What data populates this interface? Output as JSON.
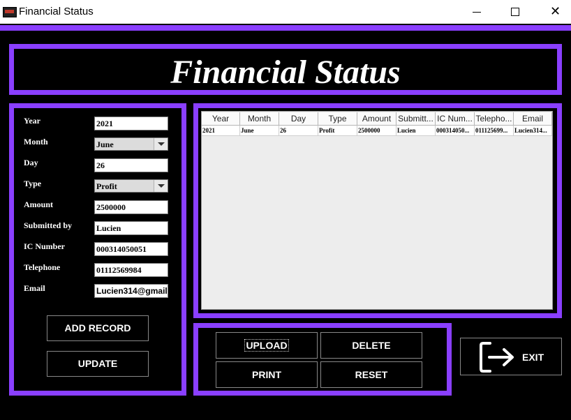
{
  "window": {
    "title": "Financial Status"
  },
  "header": {
    "title": "Financial Status"
  },
  "form": {
    "year_label": "Year",
    "year_value": "2021",
    "month_label": "Month",
    "month_value": "June",
    "day_label": "Day",
    "day_value": "26",
    "type_label": "Type",
    "type_value": "Profit",
    "amount_label": "Amount",
    "amount_value": "2500000",
    "submitted_label": "Submitted by",
    "submitted_value": "Lucien",
    "ic_label": "IC Number",
    "ic_value": "000314050051",
    "tel_label": "Telephone",
    "tel_value": "01112569984",
    "email_label": "Email",
    "email_value": "Lucien314@gmail.",
    "add_record": "ADD RECORD",
    "update": "UPDATE"
  },
  "table": {
    "headers": [
      "Year",
      "Month",
      "Day",
      "Type",
      "Amount",
      "Submitt...",
      "IC Num...",
      "Telepho...",
      "Email"
    ],
    "rows": [
      [
        "2021",
        "June",
        "26",
        "Profit",
        "2500000",
        "Lucien",
        "000314050...",
        "011125699...",
        "Lucien314..."
      ]
    ]
  },
  "actions": {
    "upload": "UPLOAD",
    "delete": "DELETE",
    "print": "PRINT",
    "reset": "RESET",
    "exit": "EXIT"
  },
  "colors": {
    "accent": "#8a3fff",
    "background": "#000000"
  }
}
